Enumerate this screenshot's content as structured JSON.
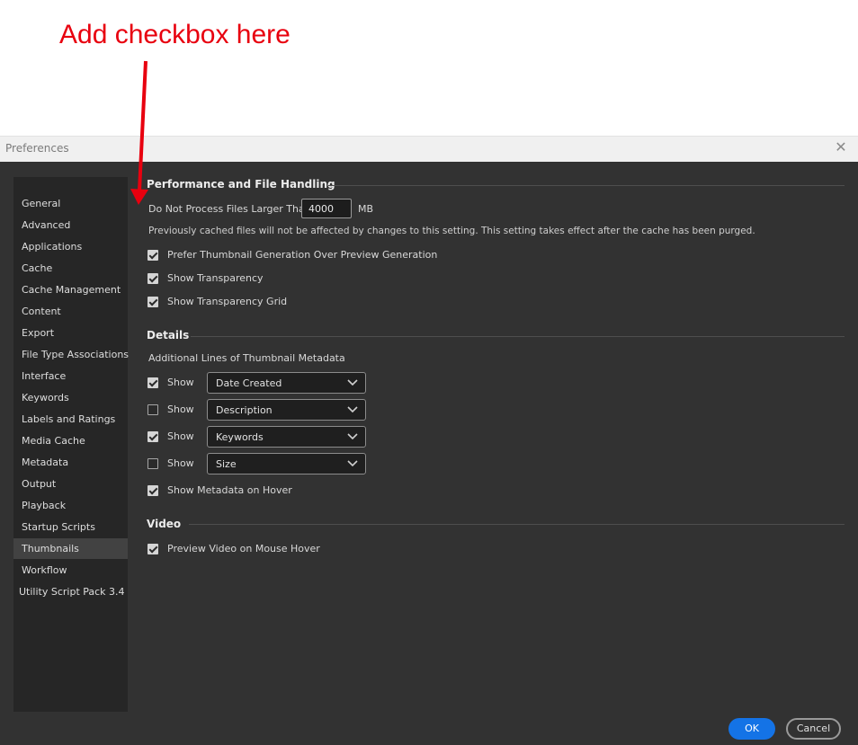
{
  "annotation": {
    "text": "Add checkbox here"
  },
  "window": {
    "title": "Preferences",
    "close_icon": "close-icon"
  },
  "sidebar": {
    "items": [
      {
        "label": "General"
      },
      {
        "label": "Advanced"
      },
      {
        "label": "Applications"
      },
      {
        "label": "Cache"
      },
      {
        "label": "Cache Management"
      },
      {
        "label": "Content"
      },
      {
        "label": "Export"
      },
      {
        "label": "File Type Associations"
      },
      {
        "label": "Interface"
      },
      {
        "label": "Keywords"
      },
      {
        "label": "Labels and Ratings"
      },
      {
        "label": "Media Cache"
      },
      {
        "label": "Metadata"
      },
      {
        "label": "Output"
      },
      {
        "label": "Playback"
      },
      {
        "label": "Startup Scripts"
      },
      {
        "label": "Thumbnails",
        "selected": true
      },
      {
        "label": "Workflow"
      },
      {
        "label": "Utility Script Pack 3.4"
      }
    ]
  },
  "performance": {
    "heading": "Performance and File Handling",
    "max_size_label": "Do Not Process Files Larger Than",
    "max_size_value": "4000",
    "max_size_unit": "MB",
    "note": "Previously cached files will not be affected by changes to this setting. This setting takes effect after the cache has been purged.",
    "prefer_thumbnail": {
      "label": "Prefer Thumbnail Generation Over Preview Generation",
      "checked": true
    },
    "show_transparency": {
      "label": "Show Transparency",
      "checked": true
    },
    "show_transparency_grid": {
      "label": "Show Transparency Grid",
      "checked": true
    }
  },
  "details": {
    "heading": "Details",
    "metadata_lines_label": "Additional Lines of Thumbnail Metadata",
    "rows": [
      {
        "show_label": "Show",
        "checked": true,
        "value": "Date Created"
      },
      {
        "show_label": "Show",
        "checked": false,
        "value": "Description"
      },
      {
        "show_label": "Show",
        "checked": true,
        "value": "Keywords"
      },
      {
        "show_label": "Show",
        "checked": false,
        "value": "Size"
      }
    ],
    "metadata_on_hover": {
      "label": "Show Metadata on Hover",
      "checked": true
    }
  },
  "video": {
    "heading": "Video",
    "preview_on_hover": {
      "label": "Preview Video on Mouse Hover",
      "checked": true
    }
  },
  "buttons": {
    "ok": "OK",
    "cancel": "Cancel"
  },
  "colors": {
    "accent": "#1473e6",
    "annotation": "#e8000f",
    "dialog_bg": "#323232",
    "sidebar_bg": "#262626"
  }
}
